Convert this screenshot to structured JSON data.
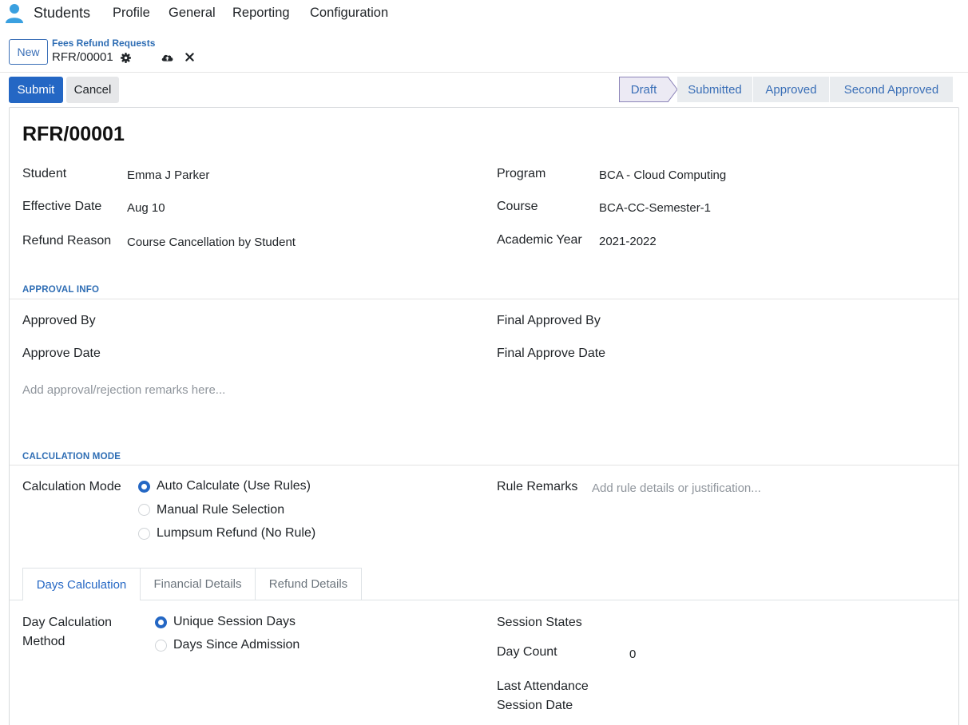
{
  "nav": {
    "app_name": "Students",
    "menus": [
      "Profile",
      "General",
      "Reporting",
      "Configuration"
    ]
  },
  "control": {
    "new_label": "New",
    "breadcrumb_parent": "Fees Refund Requests",
    "breadcrumb_current": "RFR/00001"
  },
  "actions": {
    "submit_label": "Submit",
    "cancel_label": "Cancel"
  },
  "status": {
    "stages": [
      "Draft",
      "Submitted",
      "Approved",
      "Second Approved"
    ],
    "active": "Draft"
  },
  "record": {
    "title": "RFR/00001",
    "student_label": "Student",
    "student_value": "Emma J Parker",
    "effective_date_label": "Effective Date",
    "effective_date_value": "Aug 10",
    "refund_reason_label": "Refund Reason",
    "refund_reason_value": "Course Cancellation by Student",
    "program_label": "Program",
    "program_value": "BCA - Cloud Computing",
    "course_label": "Course",
    "course_value": "BCA-CC-Semester-1",
    "academic_year_label": "Academic Year",
    "academic_year_value": "2021-2022"
  },
  "approval": {
    "section_title": "APPROVAL INFO",
    "approved_by_label": "Approved By",
    "approve_date_label": "Approve Date",
    "final_approved_by_label": "Final Approved By",
    "final_approve_date_label": "Final Approve Date",
    "remarks_placeholder": "Add approval/rejection remarks here..."
  },
  "calculation": {
    "section_title": "CALCULATION MODE",
    "mode_label": "Calculation Mode",
    "options": [
      "Auto Calculate (Use Rules)",
      "Manual Rule Selection",
      "Lumpsum Refund (No Rule)"
    ],
    "selected": "Auto Calculate (Use Rules)",
    "rule_remarks_label": "Rule Remarks",
    "rule_remarks_placeholder": "Add rule details or justification..."
  },
  "tabs": {
    "items": [
      "Days Calculation",
      "Financial Details",
      "Refund Details"
    ],
    "active": "Days Calculation"
  },
  "days": {
    "method_label_line1": "Day Calculation",
    "method_label_line2": "Method",
    "options": [
      "Unique Session Days",
      "Days Since Admission"
    ],
    "selected": "Unique Session Days",
    "session_states_label": "Session States",
    "day_count_label": "Day Count",
    "day_count_value": "0",
    "last_attendance_line1": "Last Attendance",
    "last_attendance_line2": "Session Date"
  },
  "colors": {
    "primary": "#2467c4",
    "link": "#2e6db4",
    "brand_icon": "#3aa0e0"
  },
  "icons": [
    "user-icon",
    "gear-icon",
    "cloud-upload-icon",
    "close-icon"
  ]
}
